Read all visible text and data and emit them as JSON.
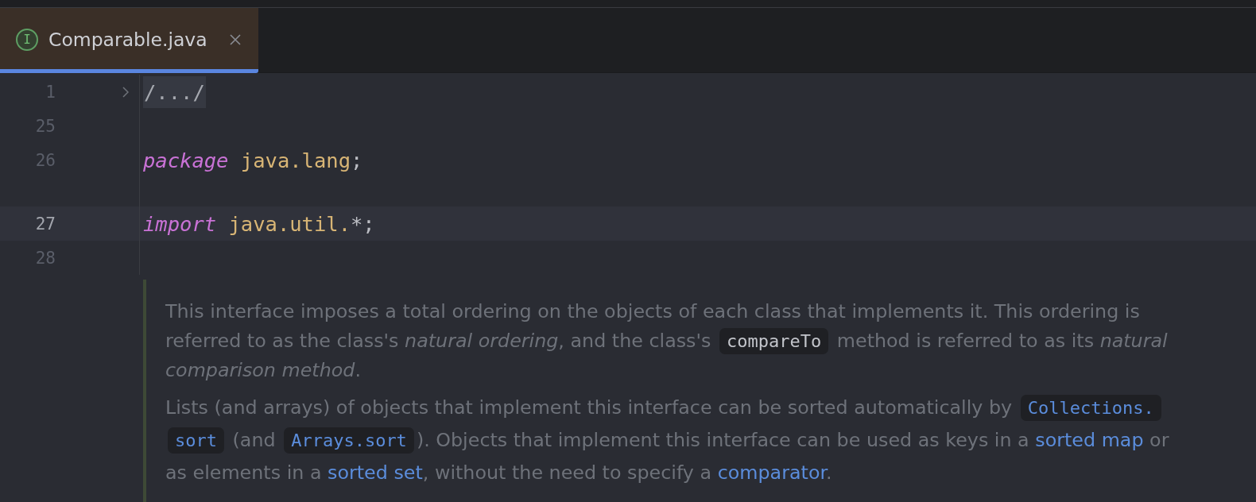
{
  "tabs": [
    {
      "label": "Comparable.java",
      "badge": "I",
      "selected": true
    }
  ],
  "code_lines": [
    {
      "number": "1",
      "kind": "folded",
      "current": false,
      "tokens": [
        {
          "text": "/.../",
          "kind": "folded"
        }
      ]
    },
    {
      "number": "25",
      "kind": "blank",
      "current": false
    },
    {
      "number": "26",
      "kind": "code",
      "current": false,
      "tokens": [
        {
          "text": "package",
          "kind": "keyword"
        },
        {
          "text": " java.lang",
          "kind": "ident"
        },
        {
          "text": ";",
          "kind": "punct"
        }
      ]
    },
    {
      "number": "27",
      "kind": "code",
      "current": true,
      "tokens": [
        {
          "text": "import",
          "kind": "keyword"
        },
        {
          "text": " java.util.",
          "kind": "ident"
        },
        {
          "text": "*;",
          "kind": "punct"
        }
      ]
    },
    {
      "number": "28",
      "kind": "blank",
      "current": false
    }
  ],
  "doc_comment": {
    "paragraphs": [
      {
        "lines": [
          [
            {
              "text": "This interface imposes a total ordering on the objects of each class that implements it. This ordering is",
              "kind": "plain"
            }
          ],
          [
            {
              "text": "referred to as the class's ",
              "kind": "plain"
            },
            {
              "text": "natural ordering",
              "kind": "italic"
            },
            {
              "text": ", and the class's ",
              "kind": "plain"
            },
            {
              "text": "compareTo",
              "kind": "code"
            },
            {
              "text": " method is referred to as its ",
              "kind": "plain"
            },
            {
              "text": "natural",
              "kind": "italic"
            }
          ],
          [
            {
              "text": "comparison method",
              "kind": "italic"
            },
            {
              "text": ".",
              "kind": "plain"
            }
          ]
        ]
      },
      {
        "lines": [
          [
            {
              "text": "Lists (and arrays) of objects that implement this interface can be sorted automatically by ",
              "kind": "plain"
            },
            {
              "text": "Collections.",
              "kind": "code_link"
            }
          ],
          [
            {
              "text": "sort",
              "kind": "code_link"
            },
            {
              "text": " (and ",
              "kind": "plain"
            },
            {
              "text": "Arrays.sort",
              "kind": "code_link"
            },
            {
              "text": "). Objects that implement this interface can be used as keys in a ",
              "kind": "plain"
            },
            {
              "text": "sorted map",
              "kind": "link"
            },
            {
              "text": " or",
              "kind": "plain"
            }
          ],
          [
            {
              "text": "as elements in a ",
              "kind": "plain"
            },
            {
              "text": "sorted set",
              "kind": "link"
            },
            {
              "text": ", without the need to specify a ",
              "kind": "plain"
            },
            {
              "text": "comparator",
              "kind": "link"
            },
            {
              "text": ".",
              "kind": "plain"
            }
          ]
        ]
      }
    ]
  }
}
